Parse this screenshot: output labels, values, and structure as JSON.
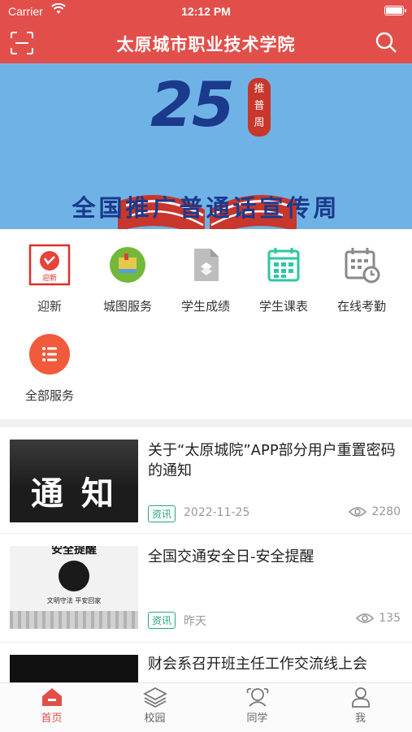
{
  "status_bar": {
    "carrier": "Carrier",
    "time": "12:12 PM"
  },
  "header": {
    "title": "太原城市职业技术学院",
    "scan_icon": "scan-icon",
    "search_icon": "search-icon"
  },
  "banner": {
    "number": "25",
    "seal_text": [
      "推",
      "普",
      "周"
    ],
    "slogan": "全国推广普通话宣传周"
  },
  "services": [
    {
      "label": "迎新",
      "icon": "welcome-icon",
      "badge": "迎新"
    },
    {
      "label": "城图服务",
      "icon": "library-icon"
    },
    {
      "label": "学生成绩",
      "icon": "grades-document-icon"
    },
    {
      "label": "学生课表",
      "icon": "timetable-icon"
    },
    {
      "label": "在线考勤",
      "icon": "attendance-calendar-icon"
    },
    {
      "label": "全部服务",
      "icon": "list-icon",
      "color": "#f15a3a"
    }
  ],
  "news": [
    {
      "title": "关于“太原城院”APP部分用户重置密码的通知",
      "tag": "资讯",
      "date": "2022-11-25",
      "views": "2280",
      "thumb_text": "通 知"
    },
    {
      "title": "全国交通安全日-安全提醒",
      "tag": "资讯",
      "date": "昨天",
      "views": "135",
      "thumb_top": "安全提醒",
      "thumb_slogan": "文明守法 平安回家"
    },
    {
      "title": "财会系召开班主任工作交流线上会"
    }
  ],
  "tabbar": [
    {
      "label": "首页",
      "icon": "home-icon",
      "active": true
    },
    {
      "label": "校园",
      "icon": "layers-icon"
    },
    {
      "label": "同学",
      "icon": "classmates-icon"
    },
    {
      "label": "我",
      "icon": "person-icon"
    }
  ],
  "colors": {
    "brand": "#e24f4a",
    "banner_bg": "#6fb3e6",
    "tag": "#2aa876"
  }
}
